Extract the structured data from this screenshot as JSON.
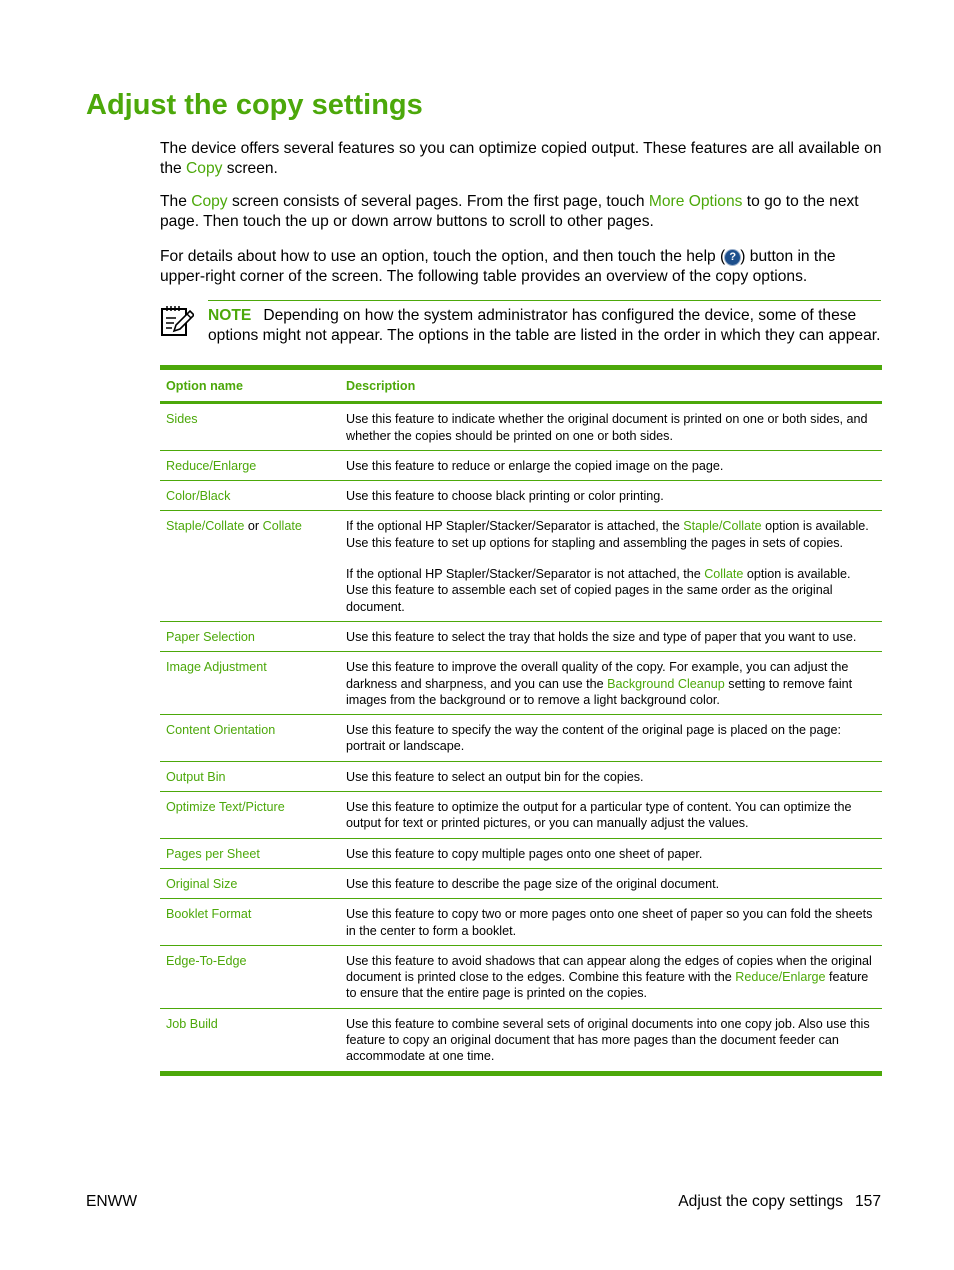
{
  "page": {
    "title": "Adjust the copy settings",
    "paragraphs": {
      "p1": {
        "t1": "The device offers several features so you can optimize copied output. These features are all available on the ",
        "link1": "Copy",
        "t2": " screen."
      },
      "p2": {
        "t1": "The ",
        "link1": "Copy",
        "t2": " screen consists of several pages. From the first page, touch ",
        "link2": "More Options",
        "t3": " to go to the next page. Then touch the up or down arrow buttons to scroll to other pages."
      },
      "p3": {
        "t1": "For details about how to use an option, touch the option, and then touch the help (",
        "help_icon": "?",
        "t2": ") button in the upper-right corner of the screen. The following table provides an overview of the copy options."
      }
    },
    "note": {
      "icon": "note-pencil-icon",
      "label": "NOTE",
      "text": "Depending on how the system administrator has configured the device, some of these options might not appear. The options in the table are listed in the order in which they can appear."
    },
    "table": {
      "headers": [
        "Option name",
        "Description"
      ],
      "rows": [
        {
          "name": "Sides",
          "desc": "Use this feature to indicate whether the original document is printed on one or both sides, and whether the copies should be printed on one or both sides."
        },
        {
          "name": "Reduce/Enlarge",
          "desc": "Use this feature to reduce or enlarge the copied image on the page."
        },
        {
          "name": "Color/Black",
          "desc": "Use this feature to choose black printing or color printing."
        },
        {
          "name_a": "Staple/Collate",
          "name_or": " or ",
          "name_b": "Collate",
          "desc_p1_t1": "If the optional HP Stapler/Stacker/Separator is attached, the ",
          "desc_p1_link": "Staple/Collate",
          "desc_p1_t2": " option is available. Use this feature to set up options for stapling and assembling the pages in sets of copies.",
          "desc_p2_t1": "If the optional HP Stapler/Stacker/Separator is not attached, the ",
          "desc_p2_link": "Collate",
          "desc_p2_t2": " option is available. Use this feature to assemble each set of copied pages in the same order as the original document."
        },
        {
          "name": "Paper Selection",
          "desc": "Use this feature to select the tray that holds the size and type of paper that you want to use."
        },
        {
          "name": "Image Adjustment",
          "desc_t1": "Use this feature to improve the overall quality of the copy. For example, you can adjust the darkness and sharpness, and you can use the ",
          "desc_link": "Background Cleanup",
          "desc_t2": " setting to remove faint images from the background or to remove a light background color."
        },
        {
          "name": "Content Orientation",
          "desc": "Use this feature to specify the way the content of the original page is placed on the page: portrait or landscape."
        },
        {
          "name": "Output Bin",
          "desc": "Use this feature to select an output bin for the copies."
        },
        {
          "name": "Optimize Text/Picture",
          "desc": "Use this feature to optimize the output for a particular type of content. You can optimize the output for text or printed pictures, or you can manually adjust the values."
        },
        {
          "name": "Pages per Sheet",
          "desc": "Use this feature to copy multiple pages onto one sheet of paper."
        },
        {
          "name": "Original Size",
          "desc": "Use this feature to describe the page size of the original document."
        },
        {
          "name": "Booklet Format",
          "desc": "Use this feature to copy two or more pages onto one sheet of paper so you can fold the sheets in the center to form a booklet."
        },
        {
          "name": "Edge-To-Edge",
          "desc_t1": "Use this feature to avoid shadows that can appear along the edges of copies when the original document is printed close to the edges. Combine this feature with the ",
          "desc_link": "Reduce/Enlarge",
          "desc_t2": " feature to ensure that the entire page is printed on the copies."
        },
        {
          "name": "Job Build",
          "desc": "Use this feature to combine several sets of original documents into one copy job. Also use this feature to copy an original document that has more pages than the document feeder can accommodate at one time."
        }
      ]
    },
    "footer": {
      "left": "ENWW",
      "section": "Adjust the copy settings",
      "page_number": "157"
    },
    "colors": {
      "accent": "#4ca80a",
      "help_icon": "#1d4f8c"
    }
  }
}
